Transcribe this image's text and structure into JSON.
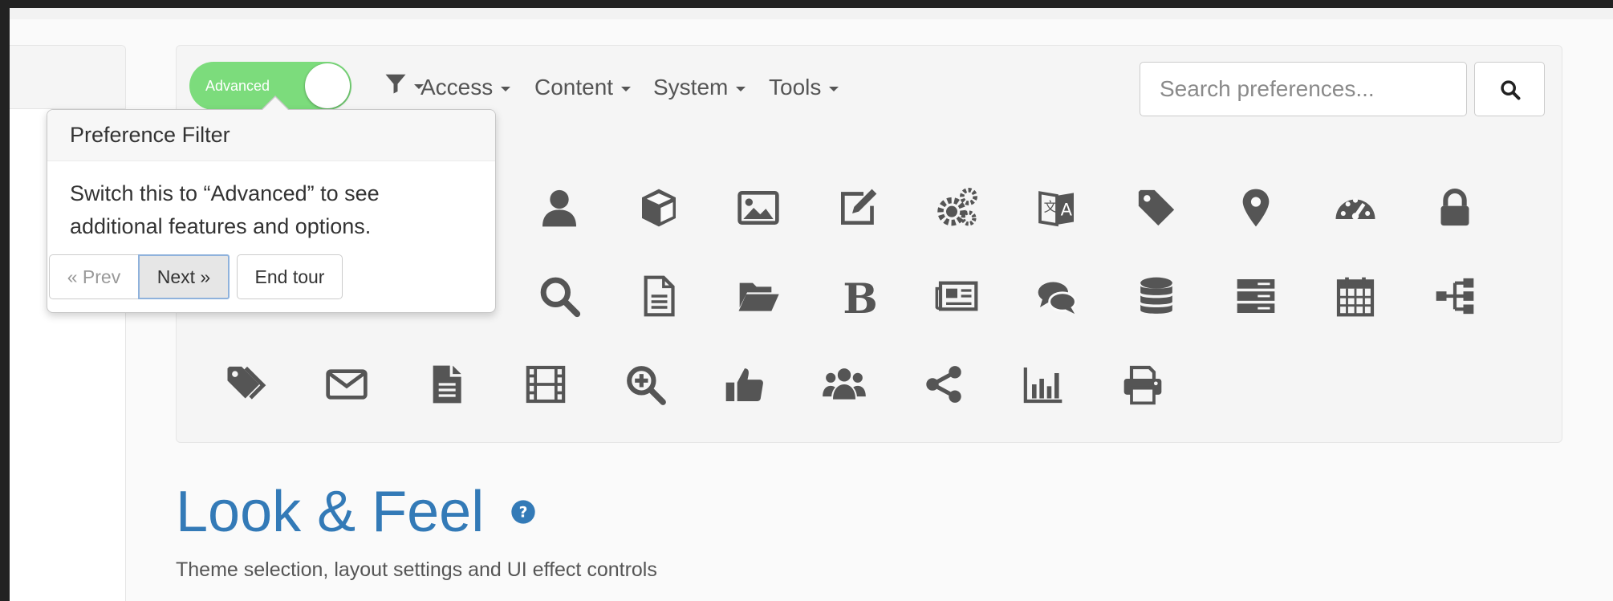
{
  "toolbar": {
    "mode_toggle_label": "Advanced",
    "filter_icon": "filter-icon",
    "menus": [
      {
        "label": "Access"
      },
      {
        "label": "Content"
      },
      {
        "label": "System"
      },
      {
        "label": "Tools"
      }
    ],
    "search_placeholder": "Search preferences...",
    "search_icon": "search-icon"
  },
  "popover": {
    "title": "Preference Filter",
    "body_line1": "Switch this to “Advanced” to see",
    "body_line2": "additional features and options.",
    "prev_label": "« Prev",
    "next_label": "Next »",
    "end_label": "End tour"
  },
  "icon_grid": {
    "color": "#555555",
    "row1": [
      "user-icon",
      "cube-icon",
      "image-icon",
      "edit-icon",
      "cogs-icon",
      "language-icon",
      "tag-icon",
      "map-marker-icon",
      "dashboard-icon",
      "lock-icon"
    ],
    "row2": [
      "search-icon",
      "file-text-icon",
      "folder-open-icon",
      "bold-icon",
      "newspaper-icon",
      "comments-icon",
      "database-icon",
      "server-icon",
      "calendar-icon",
      "sitemap-icon"
    ],
    "row3": [
      "tags-icon",
      "envelope-icon",
      "file-icon",
      "film-icon",
      "zoom-in-icon",
      "thumbs-up-icon",
      "users-icon",
      "share-icon",
      "bar-chart-icon",
      "print-icon"
    ]
  },
  "section": {
    "title": "Look & Feel",
    "help_icon": "question-circle-icon",
    "subtitle": "Theme selection, layout settings and UI effect controls"
  },
  "colors": {
    "toggle_on": "#7cdc7c",
    "title_blue": "#337ab7",
    "icon_gray": "#555555"
  }
}
